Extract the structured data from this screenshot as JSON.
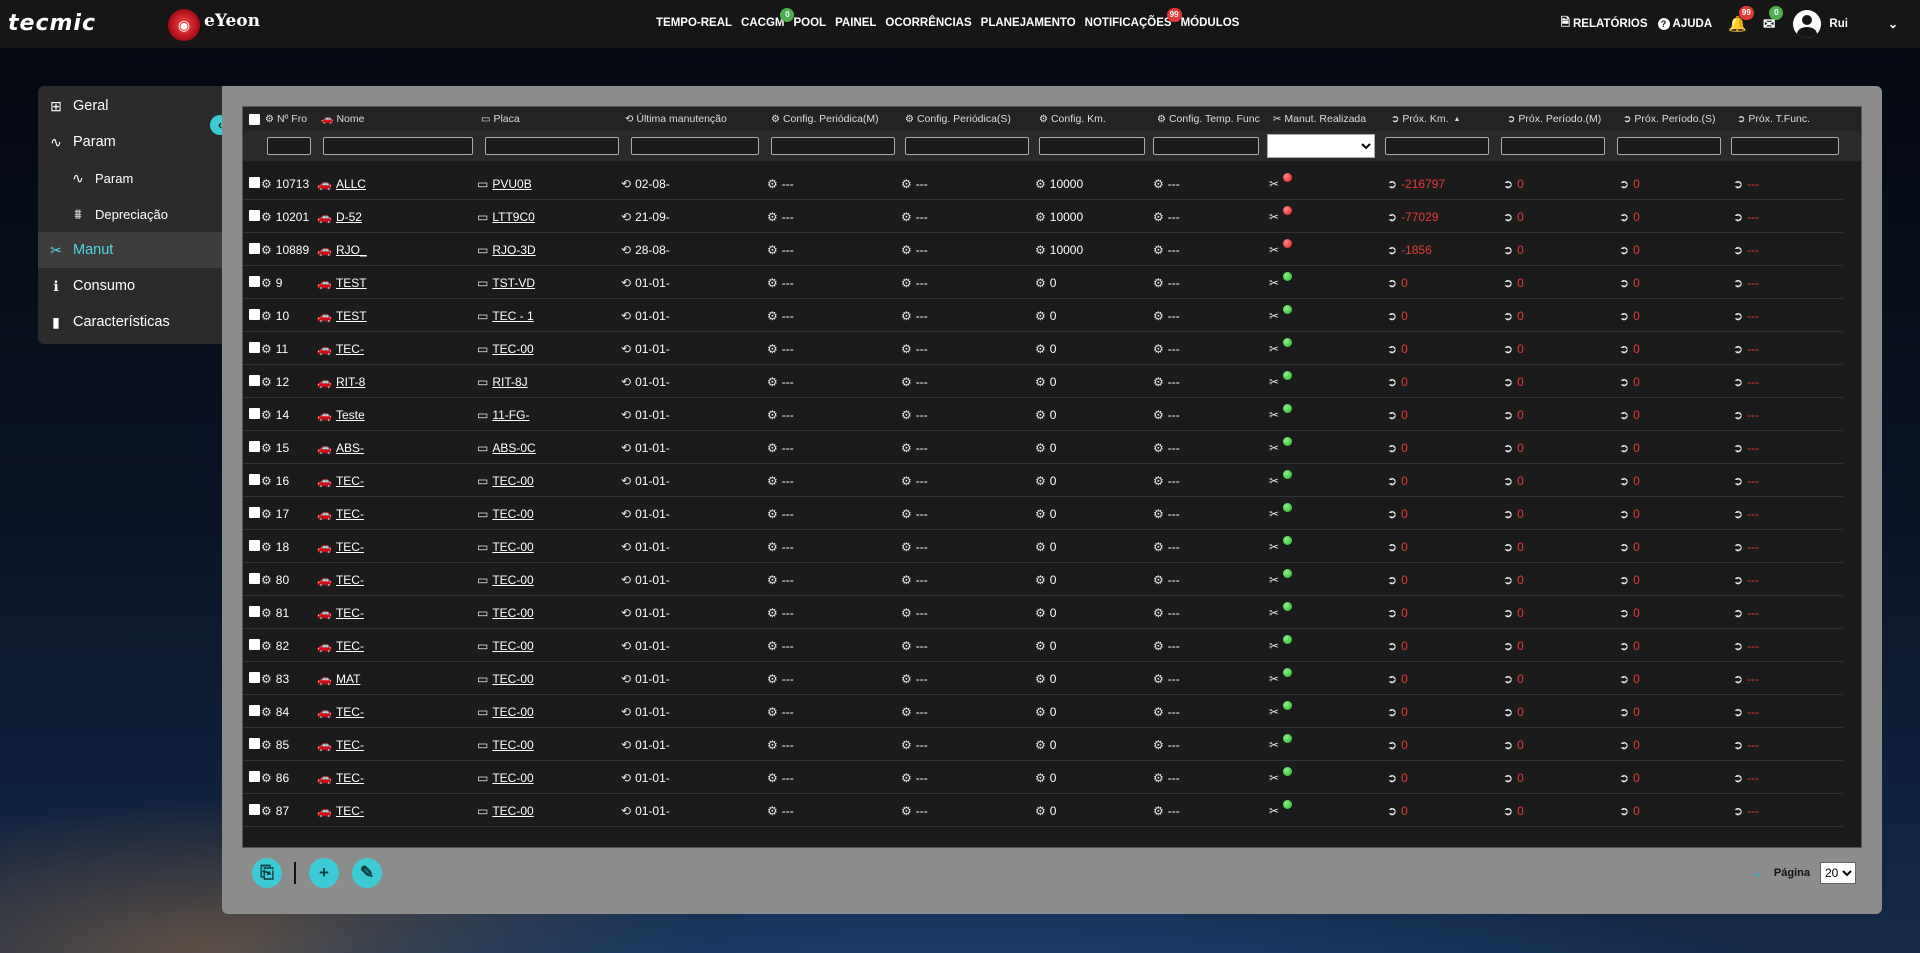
{
  "brand": {
    "logo1": "tecmic",
    "logo2": "eYeon"
  },
  "nav": [
    {
      "label": "TEMPO-REAL"
    },
    {
      "label": "CACGM",
      "badge": "0",
      "badge_color": "green"
    },
    {
      "label": "POOL"
    },
    {
      "label": "PAINEL"
    },
    {
      "label": "OCORRÊNCIAS"
    },
    {
      "label": "PLANEJAMENTO"
    },
    {
      "label": "NOTIFICAÇÕES",
      "badge": "99",
      "badge_color": "red"
    },
    {
      "label": "MÓDULOS"
    }
  ],
  "right_nav": {
    "reports": "RELATÓRIOS",
    "help": "AJUDA",
    "bell_badge": "99",
    "mail_badge": "0",
    "user": "Rui"
  },
  "sidemenu": [
    {
      "label": "Geral",
      "icon": "grid-icon",
      "glyph": "⊞",
      "sub": false,
      "active": false
    },
    {
      "label": "Param",
      "icon": "wave-icon",
      "glyph": "∿",
      "sub": false,
      "active": false
    },
    {
      "label": "Param",
      "icon": "wave-icon",
      "glyph": "∿",
      "sub": true,
      "active": false
    },
    {
      "label": "Depreciação",
      "icon": "depreciation-icon",
      "glyph": "⩩",
      "sub": true,
      "active": false
    },
    {
      "label": "Manut",
      "icon": "tools-icon",
      "glyph": "✂",
      "sub": false,
      "active": true
    },
    {
      "label": "Consumo",
      "icon": "info-icon",
      "glyph": "ℹ",
      "sub": false,
      "active": false
    },
    {
      "label": "Características",
      "icon": "document-icon",
      "glyph": "▮",
      "sub": false,
      "active": false
    }
  ],
  "columns": [
    {
      "key": "fleet",
      "label": "Nº Fro",
      "icon": "fleet-icon",
      "glyph": "⚙"
    },
    {
      "key": "name",
      "label": "Nome",
      "icon": "car-icon",
      "glyph": "🚗"
    },
    {
      "key": "plate",
      "label": "Placa",
      "icon": "plate-icon",
      "glyph": "▭"
    },
    {
      "key": "last",
      "label": "Última manutenção",
      "icon": "maintenance-icon",
      "glyph": "⟲"
    },
    {
      "key": "cpm",
      "label": "Config. Periódica(M)",
      "icon": "gear-icon",
      "glyph": "⚙"
    },
    {
      "key": "cps",
      "label": "Config. Periódica(S)",
      "icon": "gear-icon",
      "glyph": "⚙"
    },
    {
      "key": "ckm",
      "label": "Config. Km.",
      "icon": "gear-icon",
      "glyph": "⚙"
    },
    {
      "key": "ctf",
      "label": "Config. Temp. Func",
      "icon": "gear-icon",
      "glyph": "⚙"
    },
    {
      "key": "done",
      "label": "Manut. Realizada",
      "icon": "tools-icon",
      "glyph": "✂"
    },
    {
      "key": "nkm",
      "label": "Próx. Km.",
      "icon": "next-icon",
      "glyph": "➲"
    },
    {
      "key": "npm",
      "label": "Próx. Período.(M)",
      "icon": "next-icon",
      "glyph": "➲"
    },
    {
      "key": "nps",
      "label": "Próx. Período.(S)",
      "icon": "next-icon",
      "glyph": "➲"
    },
    {
      "key": "ntf",
      "label": "Próx. T.Func.",
      "icon": "next-icon",
      "glyph": "➲"
    }
  ],
  "sort_indicator": "▲",
  "rows": [
    {
      "fleet": "10713",
      "name": "ALLC",
      "plate": "PVU0B",
      "last": "02-08-",
      "cpm": "---",
      "cps": "---",
      "ckm": "10000",
      "ctf": "---",
      "done": "red",
      "nkm": "-216797",
      "npm": "0",
      "nps": "0",
      "ntf": "---"
    },
    {
      "fleet": "10201",
      "name": "D-52",
      "plate": "LTT9C0",
      "last": "21-09-",
      "cpm": "---",
      "cps": "---",
      "ckm": "10000",
      "ctf": "---",
      "done": "red",
      "nkm": "-77029",
      "npm": "0",
      "nps": "0",
      "ntf": "---"
    },
    {
      "fleet": "10889",
      "name": "RJO_",
      "plate": "RJO-3D",
      "last": "28-08-",
      "cpm": "---",
      "cps": "---",
      "ckm": "10000",
      "ctf": "---",
      "done": "red",
      "nkm": "-1856",
      "npm": "0",
      "nps": "0",
      "ntf": "---"
    },
    {
      "fleet": "9",
      "name": "TEST",
      "plate": "TST-VD",
      "last": "01-01-",
      "cpm": "---",
      "cps": "---",
      "ckm": "0",
      "ctf": "---",
      "done": "green",
      "nkm": "0",
      "npm": "0",
      "nps": "0",
      "ntf": "---"
    },
    {
      "fleet": "10",
      "name": "TEST",
      "plate": "TEC - 1",
      "last": "01-01-",
      "cpm": "---",
      "cps": "---",
      "ckm": "0",
      "ctf": "---",
      "done": "green",
      "nkm": "0",
      "npm": "0",
      "nps": "0",
      "ntf": "---"
    },
    {
      "fleet": "11",
      "name": "TEC-",
      "plate": "TEC-00",
      "last": "01-01-",
      "cpm": "---",
      "cps": "---",
      "ckm": "0",
      "ctf": "---",
      "done": "green",
      "nkm": "0",
      "npm": "0",
      "nps": "0",
      "ntf": "---"
    },
    {
      "fleet": "12",
      "name": "RIT-8",
      "plate": "RIT-8J",
      "last": "01-01-",
      "cpm": "---",
      "cps": "---",
      "ckm": "0",
      "ctf": "---",
      "done": "green",
      "nkm": "0",
      "npm": "0",
      "nps": "0",
      "ntf": "---"
    },
    {
      "fleet": "14",
      "name": "Teste",
      "plate": "11-FG-",
      "last": "01-01-",
      "cpm": "---",
      "cps": "---",
      "ckm": "0",
      "ctf": "---",
      "done": "green",
      "nkm": "0",
      "npm": "0",
      "nps": "0",
      "ntf": "---"
    },
    {
      "fleet": "15",
      "name": "ABS-",
      "plate": "ABS-0C",
      "last": "01-01-",
      "cpm": "---",
      "cps": "---",
      "ckm": "0",
      "ctf": "---",
      "done": "green",
      "nkm": "0",
      "npm": "0",
      "nps": "0",
      "ntf": "---"
    },
    {
      "fleet": "16",
      "name": "TEC-",
      "plate": "TEC-00",
      "last": "01-01-",
      "cpm": "---",
      "cps": "---",
      "ckm": "0",
      "ctf": "---",
      "done": "green",
      "nkm": "0",
      "npm": "0",
      "nps": "0",
      "ntf": "---"
    },
    {
      "fleet": "17",
      "name": "TEC-",
      "plate": "TEC-00",
      "last": "01-01-",
      "cpm": "---",
      "cps": "---",
      "ckm": "0",
      "ctf": "---",
      "done": "green",
      "nkm": "0",
      "npm": "0",
      "nps": "0",
      "ntf": "---"
    },
    {
      "fleet": "18",
      "name": "TEC-",
      "plate": "TEC-00",
      "last": "01-01-",
      "cpm": "---",
      "cps": "---",
      "ckm": "0",
      "ctf": "---",
      "done": "green",
      "nkm": "0",
      "npm": "0",
      "nps": "0",
      "ntf": "---"
    },
    {
      "fleet": "80",
      "name": "TEC-",
      "plate": "TEC-00",
      "last": "01-01-",
      "cpm": "---",
      "cps": "---",
      "ckm": "0",
      "ctf": "---",
      "done": "green",
      "nkm": "0",
      "npm": "0",
      "nps": "0",
      "ntf": "---"
    },
    {
      "fleet": "81",
      "name": "TEC-",
      "plate": "TEC-00",
      "last": "01-01-",
      "cpm": "---",
      "cps": "---",
      "ckm": "0",
      "ctf": "---",
      "done": "green",
      "nkm": "0",
      "npm": "0",
      "nps": "0",
      "ntf": "---"
    },
    {
      "fleet": "82",
      "name": "TEC-",
      "plate": "TEC-00",
      "last": "01-01-",
      "cpm": "---",
      "cps": "---",
      "ckm": "0",
      "ctf": "---",
      "done": "green",
      "nkm": "0",
      "npm": "0",
      "nps": "0",
      "ntf": "---"
    },
    {
      "fleet": "83",
      "name": "MAT",
      "plate": "TEC-00",
      "last": "01-01-",
      "cpm": "---",
      "cps": "---",
      "ckm": "0",
      "ctf": "---",
      "done": "green",
      "nkm": "0",
      "npm": "0",
      "nps": "0",
      "ntf": "---"
    },
    {
      "fleet": "84",
      "name": "TEC-",
      "plate": "TEC-00",
      "last": "01-01-",
      "cpm": "---",
      "cps": "---",
      "ckm": "0",
      "ctf": "---",
      "done": "green",
      "nkm": "0",
      "npm": "0",
      "nps": "0",
      "ntf": "---"
    },
    {
      "fleet": "85",
      "name": "TEC-",
      "plate": "TEC-00",
      "last": "01-01-",
      "cpm": "---",
      "cps": "---",
      "ckm": "0",
      "ctf": "---",
      "done": "green",
      "nkm": "0",
      "npm": "0",
      "nps": "0",
      "ntf": "---"
    },
    {
      "fleet": "86",
      "name": "TEC-",
      "plate": "TEC-00",
      "last": "01-01-",
      "cpm": "---",
      "cps": "---",
      "ckm": "0",
      "ctf": "---",
      "done": "green",
      "nkm": "0",
      "npm": "0",
      "nps": "0",
      "ntf": "---"
    },
    {
      "fleet": "87",
      "name": "TEC-",
      "plate": "TEC-00",
      "last": "01-01-",
      "cpm": "---",
      "cps": "---",
      "ckm": "0",
      "ctf": "---",
      "done": "green",
      "nkm": "0",
      "npm": "0",
      "nps": "0",
      "ntf": "---"
    }
  ],
  "footer": {
    "page_label": "Página",
    "page_size": "20",
    "buttons": [
      {
        "name": "export-button",
        "glyph": "⎘"
      },
      {
        "name": "add-button",
        "glyph": "+"
      },
      {
        "name": "edit-button",
        "glyph": "✎"
      }
    ]
  },
  "colors": {
    "accent": "#3ccbd4",
    "danger": "#e53935",
    "ok": "#1fb61f"
  }
}
